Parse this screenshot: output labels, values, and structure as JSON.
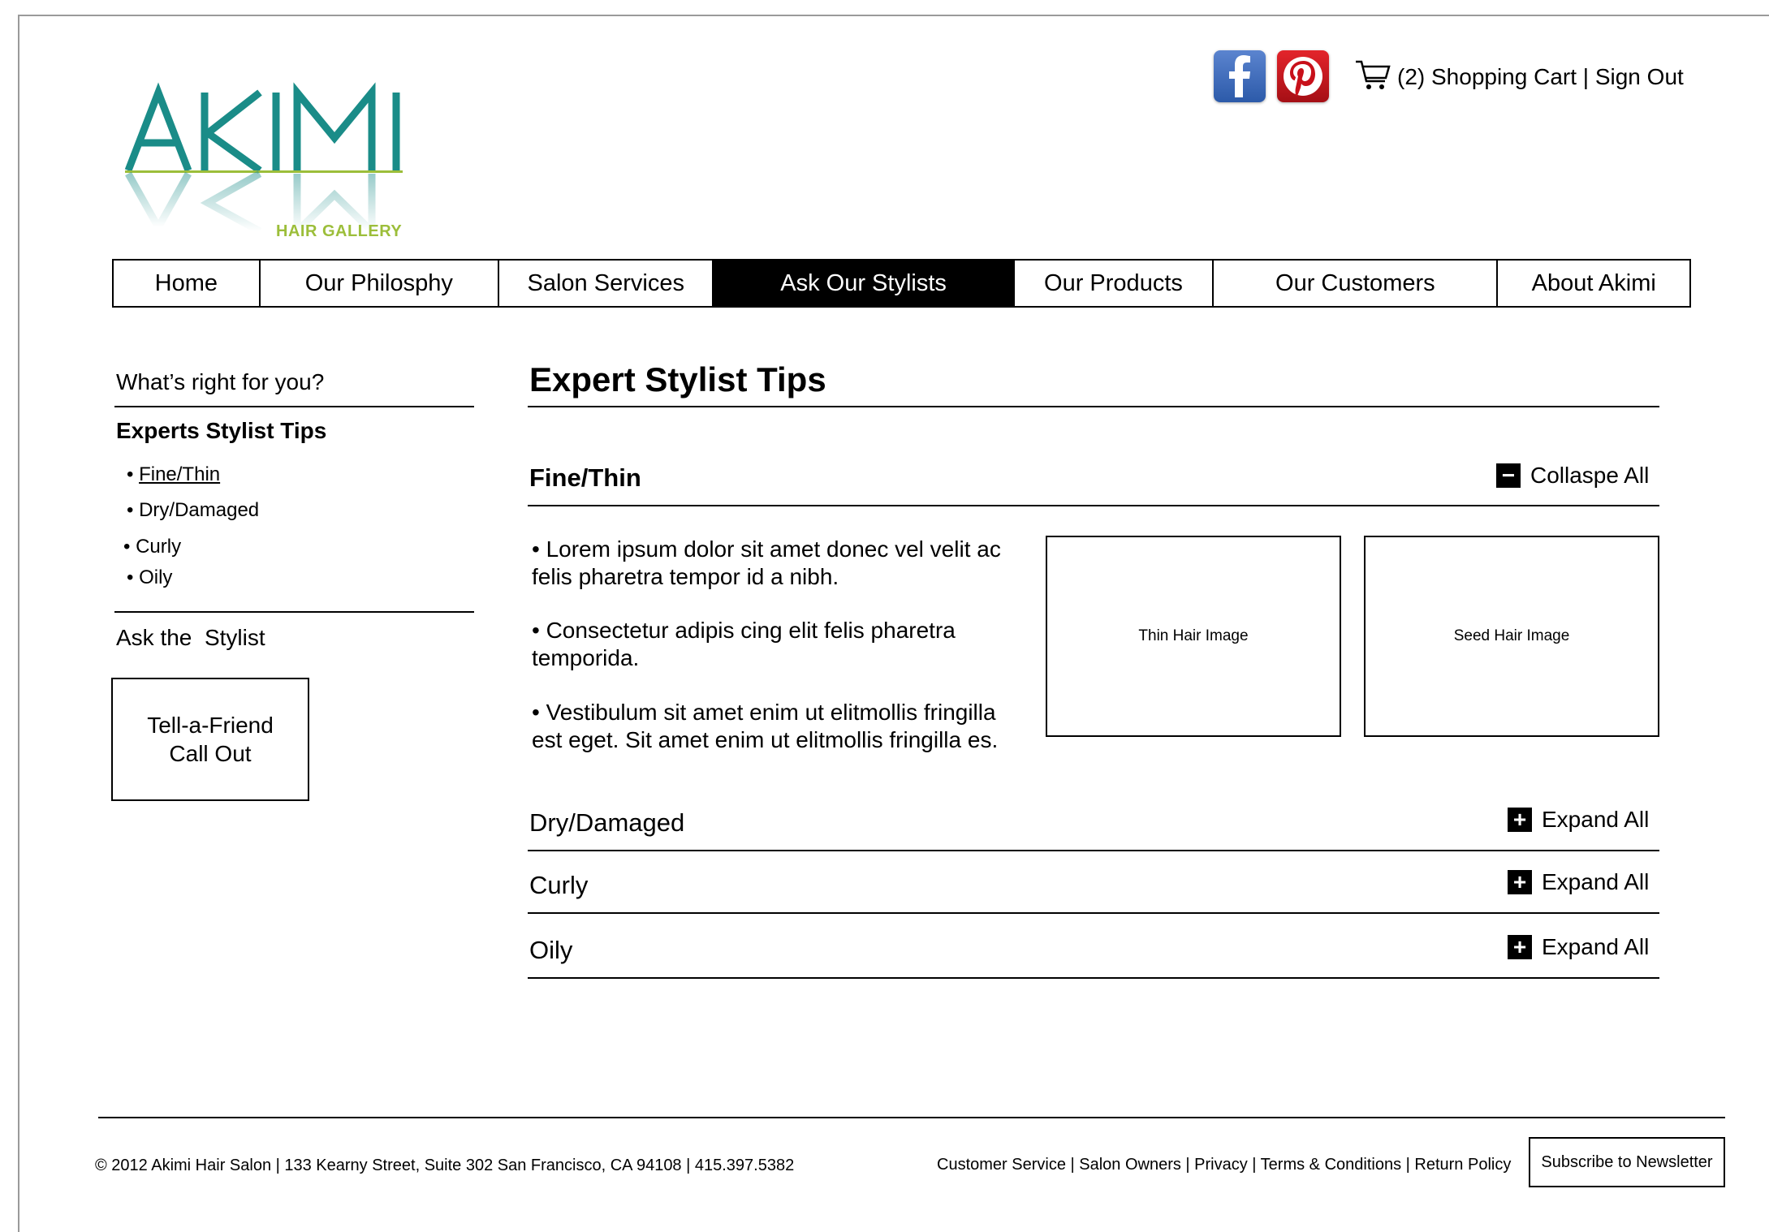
{
  "logo": {
    "name": "AKIMI",
    "sub": "HAIR GALLERY",
    "colors": {
      "teal": "#1a8c88",
      "green": "#9cbe3a"
    }
  },
  "header": {
    "social": [
      {
        "icon": "facebook-icon"
      },
      {
        "icon": "pinterest-icon"
      }
    ],
    "cart_text": "(2) Shopping Cart | Sign Out"
  },
  "nav": {
    "items": [
      {
        "label": "Home"
      },
      {
        "label": "Our Philosphy"
      },
      {
        "label": "Salon Services"
      },
      {
        "label": "Ask Our Stylists",
        "active": true
      },
      {
        "label": "Our Products"
      },
      {
        "label": "Our Customers"
      },
      {
        "label": "About Akimi"
      }
    ]
  },
  "sidebar": {
    "question": "What’s right for you?",
    "heading": "Experts Stylist Tips",
    "links": [
      "Fine/Thin",
      "Dry/Damaged",
      "Curly",
      "Oily"
    ],
    "ask": "Ask the  Stylist",
    "callout_line1": "Tell-a-Friend",
    "callout_line2": "Call Out"
  },
  "main": {
    "title": "Expert Stylist Tips",
    "sections": [
      {
        "title": "Fine/Thin",
        "toggle": "Collaspe All",
        "toggle_symbol": "−"
      },
      {
        "title": "Dry/Damaged",
        "toggle": "Expand All",
        "toggle_symbol": "+"
      },
      {
        "title": "Curly",
        "toggle": "Expand All",
        "toggle_symbol": "+"
      },
      {
        "title": "Oily",
        "toggle": "Expand All",
        "toggle_symbol": "+"
      }
    ],
    "bullets": [
      "• Lorem ipsum dolor sit amet donec vel velit ac felis pharetra tempor id a nibh.",
      "• Consectetur adipis cing elit felis pharetra temporida.",
      "• Vestibulum sit amet enim ut elitmollis fringilla est eget. Sit amet enim ut elitmollis fringilla es."
    ],
    "images": [
      "Thin Hair Image",
      "Seed Hair Image"
    ]
  },
  "footer": {
    "left": "© 2012 Akimi Hair Salon | 133 Kearny Street, Suite 302 San Francisco, CA 94108 | 415.397.5382",
    "links": "Customer Service | Salon Owners | Privacy | Terms & Conditions | Return Policy",
    "subscribe": "Subscribe to Newsletter"
  }
}
